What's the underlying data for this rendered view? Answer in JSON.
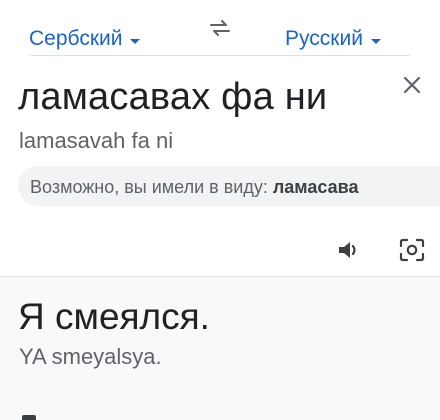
{
  "header": {
    "source_language": "Сербский",
    "target_language": "Русский",
    "swap_icon": "swap-arrows-icon",
    "accent_color": "#1a64c7"
  },
  "input": {
    "text": "ламасавах фа ни",
    "transliteration": "lamasavah fa ni",
    "suggestion_prefix": "Возможно, вы имели в виду: ",
    "suggestion_value": "ламасава",
    "clear_icon": "close-icon",
    "speak_icon": "speaker-icon",
    "camera_icon": "camera-icon"
  },
  "output": {
    "text": "Я смеялся.",
    "transliteration": "YA smeyalsya."
  }
}
